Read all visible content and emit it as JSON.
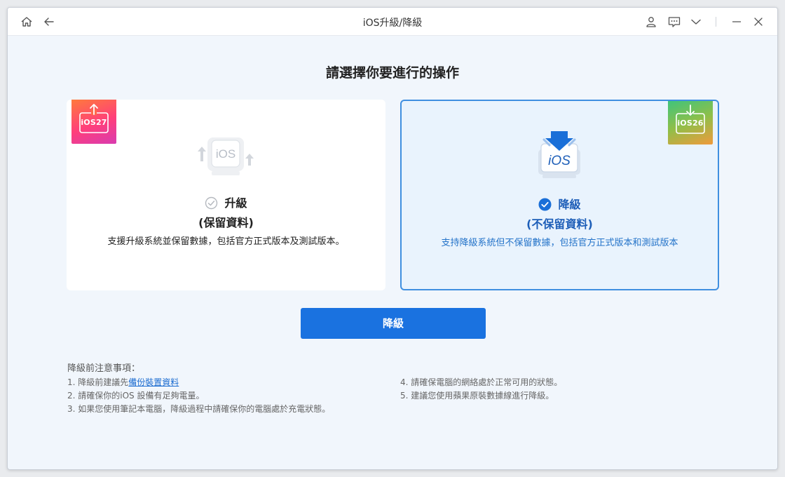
{
  "window": {
    "title": "iOS升級/降級"
  },
  "heading": "請選擇你要進行的操作",
  "options": {
    "upgrade": {
      "badge": "iOS27",
      "illustration": "iOS",
      "label": "升級",
      "sub": "(保留資料)",
      "desc": "支援升級系統並保留數據，包括官方正式版本及測試版本。",
      "selected": false,
      "icon": "upload-arrow-icon"
    },
    "downgrade": {
      "badge": "iOS26",
      "illustration": "iOS",
      "label": "降級",
      "sub": "(不保留資料)",
      "desc": "支持降級系統但不保留數據，包括官方正式版本和測試版本",
      "selected": true,
      "icon": "download-arrow-icon"
    }
  },
  "primary_button": "降級",
  "notes": {
    "title": "降級前注意事項：",
    "n1_prefix": "1. 降級前建議先",
    "n1_link": "備份裝置資料",
    "n2": "2. 請確保你的iOS 設備有足夠電量。",
    "n3": "3. 如果您使用筆記本電腦，降級過程中請確保你的電腦處於充電狀態。",
    "n4": "4. 請確保電腦的網絡處於正常可用的狀態。",
    "n5": "5. 建議您使用蘋果原裝數據線進行降級。"
  },
  "colors": {
    "accent": "#1a72e0",
    "selected_border": "#3f8fe0",
    "selected_bg": "#e9f3fd",
    "selected_text": "#1d5eb8"
  }
}
